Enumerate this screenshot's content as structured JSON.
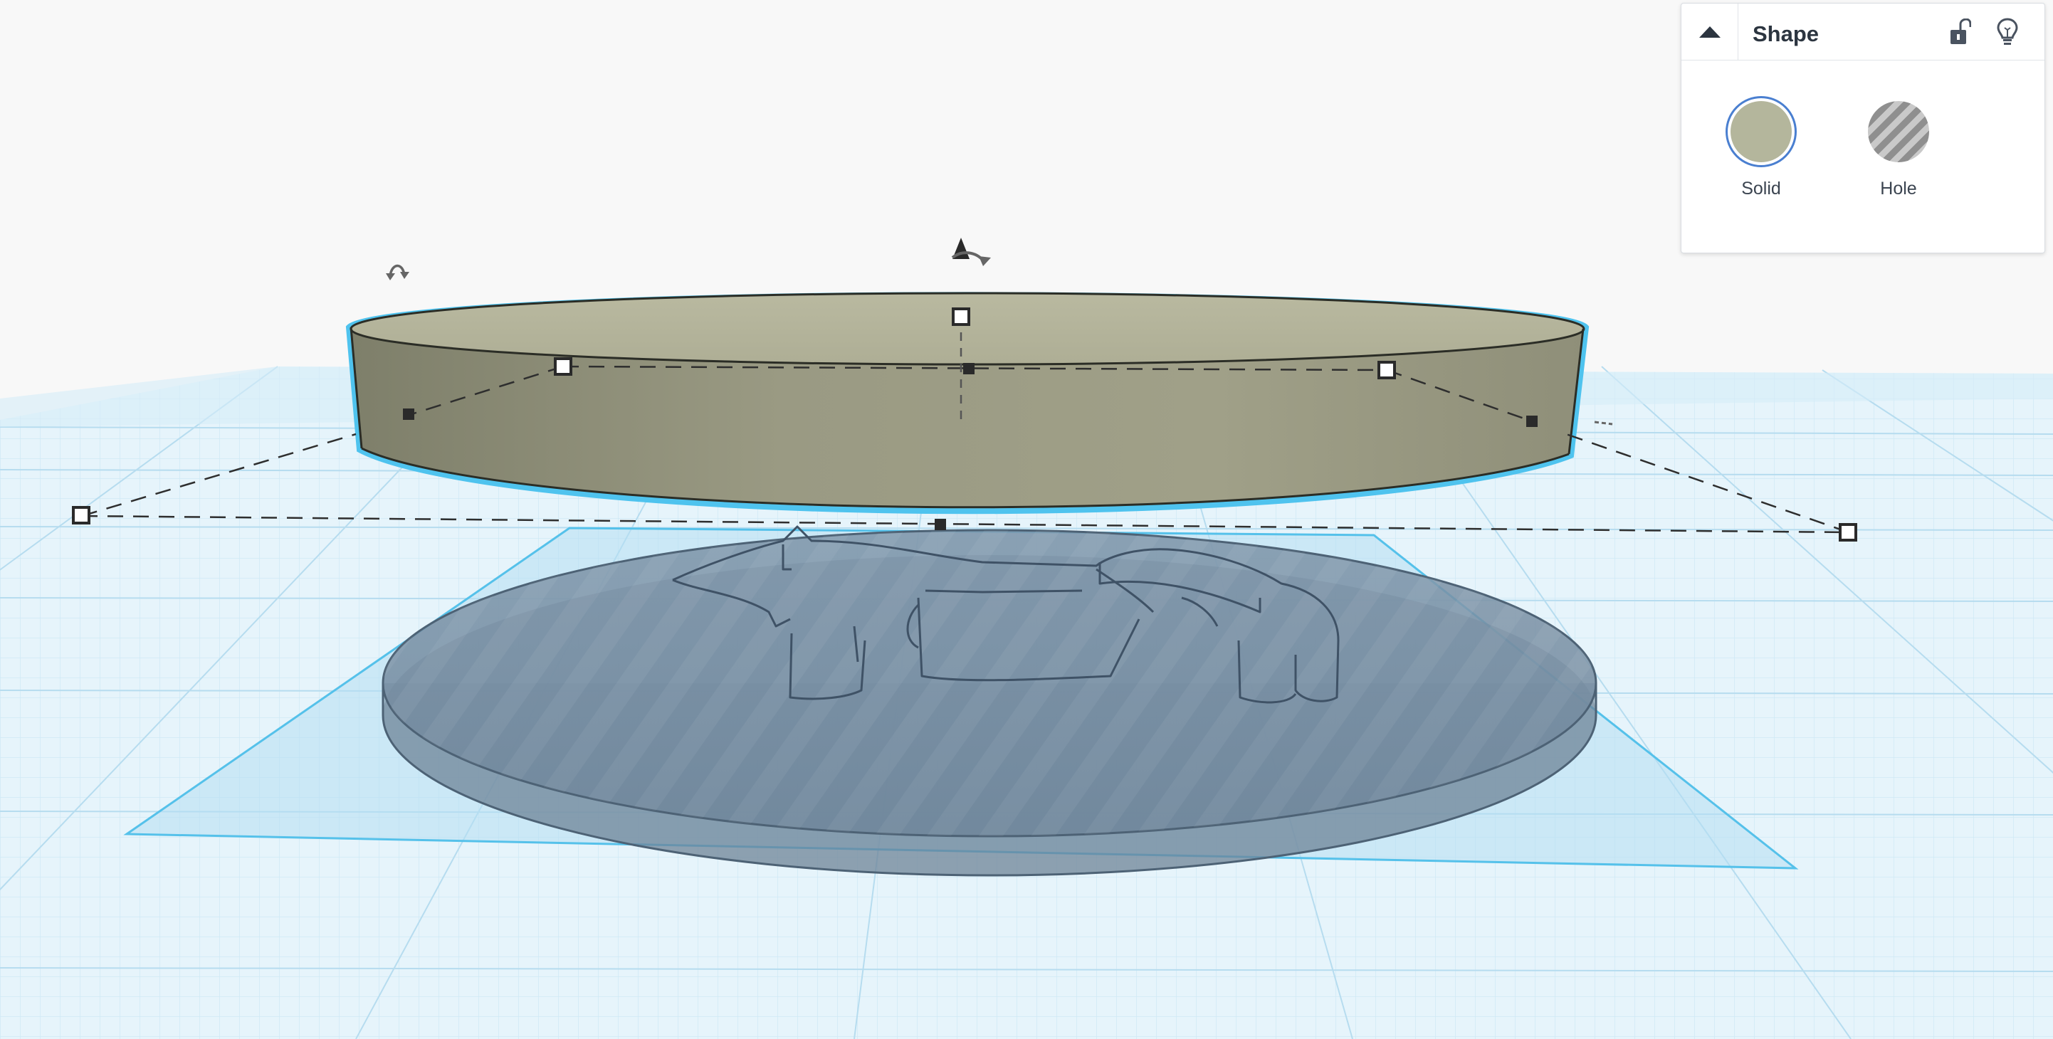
{
  "panel": {
    "title": "Shape",
    "options": [
      {
        "label": "Solid",
        "selected": true,
        "color": "#b4b69c"
      },
      {
        "label": "Hole",
        "selected": false
      }
    ],
    "icons": {
      "collapse": "triangle-up-icon",
      "lock": "unlock-icon",
      "hint": "lightbulb-icon"
    }
  },
  "colors": {
    "workplane_grid": "#bfe2f3",
    "selection_outline": "#4fc3ee",
    "solid_shape": "#a7a78d",
    "hole_shape": "#7d93a6",
    "panel_accent": "#4a7fd0"
  }
}
